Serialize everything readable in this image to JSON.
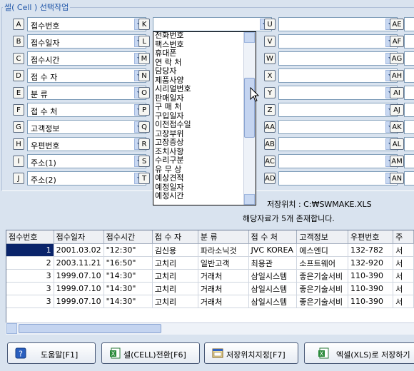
{
  "group_title": "셀( Cell ) 선택작업",
  "column1": [
    {
      "letter": "A",
      "value": "접수번호"
    },
    {
      "letter": "B",
      "value": "접수일자"
    },
    {
      "letter": "C",
      "value": "접수시간"
    },
    {
      "letter": "D",
      "value": "접 수 자"
    },
    {
      "letter": "E",
      "value": "분      류"
    },
    {
      "letter": "F",
      "value": "접 수 처"
    },
    {
      "letter": "G",
      "value": "고객정보"
    },
    {
      "letter": "H",
      "value": "우편번호"
    },
    {
      "letter": "I",
      "value": "주소(1)"
    },
    {
      "letter": "J",
      "value": "주소(2)"
    }
  ],
  "column2_letters": [
    "K",
    "L",
    "M",
    "N",
    "O",
    "P",
    "Q",
    "R",
    "S",
    "T"
  ],
  "column3_letters": [
    "U",
    "V",
    "W",
    "X",
    "Y",
    "Z",
    "AA",
    "AB",
    "AC",
    "AD"
  ],
  "column4_letters": [
    "AE",
    "AF",
    "AG",
    "AH",
    "AI",
    "AJ",
    "AK",
    "AL",
    "AM",
    "AN"
  ],
  "dropdown_items": [
    "전화번호",
    "팩스번호",
    "휴대폰",
    "연 락 처",
    "담당자",
    "제품사양",
    "시리얼번호",
    "판매일자",
    "구 매 처",
    "구입일자",
    "이전접수일",
    "고장부위",
    "고장증상",
    "조치사항",
    "수리구분",
    "유 무 상",
    "예상견적",
    "예정일자",
    "예정시간"
  ],
  "save_location": "저장위치 : C:₩SWMAKE.XLS",
  "record_count_text": "해당자료가 5개 존재합니다.",
  "table": {
    "headers": [
      "접수번호",
      "접수일자",
      "접수시간",
      "접 수 자",
      "분   류",
      "접 수 처",
      "고객정보",
      "우편번호",
      "주"
    ],
    "rows": [
      [
        "1",
        "2001.03.02",
        "\"12:30\"",
        "김신용",
        "파라소닉것",
        "JVC KOREA",
        "에스엔디",
        "132-782",
        "서"
      ],
      [
        "2",
        "2003.11.21",
        "\"16:50\"",
        "고치리",
        "일반고객",
        "최용관",
        "소프트웨어",
        "132-920",
        "서"
      ],
      [
        "3",
        "1999.07.10",
        "\"14:30\"",
        "고치리",
        "거래처",
        "삼일시스템",
        "좋은기술서비",
        "110-390",
        "서"
      ],
      [
        "3",
        "1999.07.10",
        "\"14:30\"",
        "고치리",
        "거래처",
        "삼일시스템",
        "좋은기술서비",
        "110-390",
        "서"
      ],
      [
        "3",
        "1999.07.10",
        "\"14:30\"",
        "고치리",
        "거래처",
        "삼일시스템",
        "좋은기술서비",
        "110-390",
        "서"
      ]
    ]
  },
  "buttons": {
    "help": "도움말[F1]",
    "cell_convert": "셀(CELL)전환[F6]",
    "save_location": "저장위치지정[F7]",
    "excel_save": "엑셀(XLS)로 저장하기"
  },
  "icons": {
    "help": "question-icon",
    "cell": "excel-icon",
    "save_loc": "folder-window-icon",
    "excel": "excel-icon"
  },
  "colors": {
    "selection": "#0a246a",
    "accent": "#1f55a8",
    "background": "#d9e3ef"
  }
}
